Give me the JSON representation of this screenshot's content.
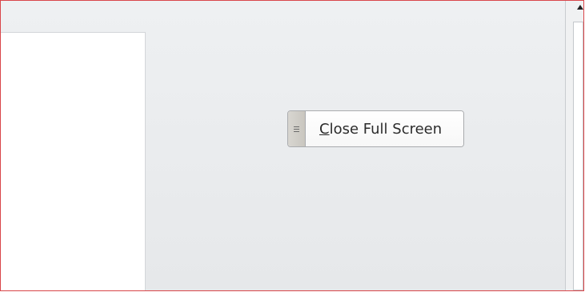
{
  "toolbar": {
    "close_full_screen": {
      "mnemonic": "C",
      "rest": "lose Full Screen",
      "grip_icon": "grip-lines-icon"
    }
  },
  "scrollbar": {
    "up_icon": "triangle-up-icon"
  },
  "colors": {
    "border_accent": "#d9464a",
    "workspace_bg": "#e8eaec",
    "page_bg": "#ffffff"
  }
}
